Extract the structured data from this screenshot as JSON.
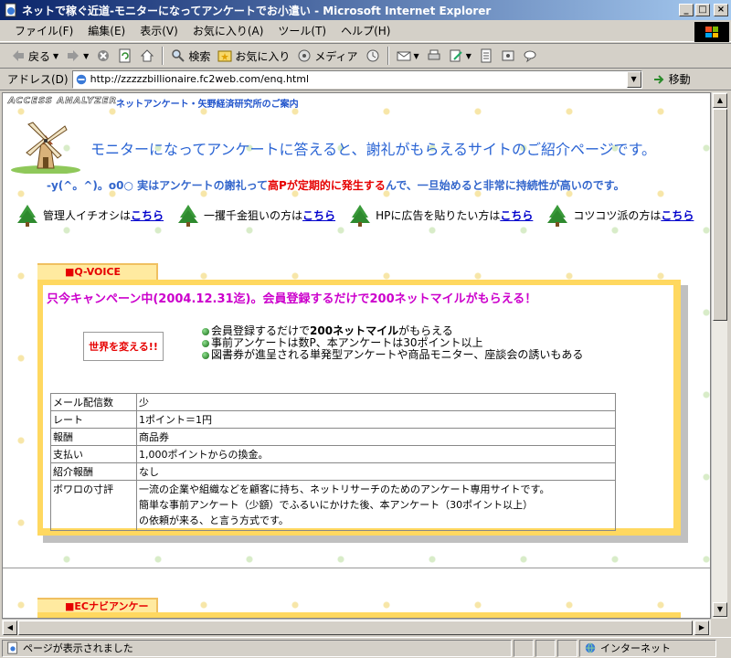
{
  "window": {
    "title": "ネットで稼ぐ近道-モニターになってアンケートでお小遣い - Microsoft Internet Explorer",
    "min": "_",
    "max": "□",
    "close": "×"
  },
  "menu": [
    "ファイル(F)",
    "編集(E)",
    "表示(V)",
    "お気に入り(A)",
    "ツール(T)",
    "ヘルプ(H)"
  ],
  "toolbar": {
    "back": "戻る",
    "search": "検索",
    "favorites": "お気に入り",
    "media": "メディア"
  },
  "address": {
    "label": "アドレス(D)",
    "url": "http://zzzzzbillionaire.fc2web.com/enq.html",
    "go": "移動"
  },
  "page": {
    "access_logo": "ACCESS ANALYZER",
    "header_link": "ネットアンケート・矢野経済研究所のご案内",
    "main_title": "モニターになってアンケートに答えると、謝礼がもらえるサイトのご紹介ページです。",
    "sub_line_pre": "-y(^。^)。o0○ 実はアンケートの謝礼って",
    "sub_line_red": "高Pが定期的に発生する",
    "sub_line_post": "んで、一旦始めると非常に持続性が高いのです。",
    "nav": [
      {
        "text": "管理人イチオシは",
        "link": "こちら"
      },
      {
        "text": "一攫千金狙いの方は",
        "link": "こちら"
      },
      {
        "text": "HPに広告を貼りたい方は",
        "link": "こちら"
      },
      {
        "text": "コツコツ派の方は",
        "link": "こちら"
      }
    ],
    "section1": {
      "tab": "■Q-VOICE",
      "campaign": "只今キャンペーン中(2004.12.31迄)。会員登録するだけで200ネットマイルがもらえる！",
      "banner": "世界を変える!!",
      "bullet1_pre": "会員登録するだけで",
      "bullet1_bold": "200ネットマイル",
      "bullet1_post": "がもらえる",
      "bullet2": "事前アンケートは数P、本アンケートは30ポイント以上",
      "bullet3": "図書券が進呈される単発型アンケートや商品モニター、座談会の誘いもある",
      "table": [
        {
          "k": "メール配信数",
          "v": "少"
        },
        {
          "k": "レート",
          "v": "1ポイント＝1円"
        },
        {
          "k": "報酬",
          "v": "商品券"
        },
        {
          "k": "支払い",
          "v": "1,000ポイントからの換金。"
        },
        {
          "k": "紹介報酬",
          "v": "なし"
        }
      ],
      "review_key": "ボワロの寸評",
      "review_1": "一流の企業や組織などを顧客に持ち、ネットリサーチのためのアンケート専用サイトです。",
      "review_2": "簡単な事前アンケート（少額）でふるいにかけた後、本アンケート（30ポイント以上）",
      "review_3": "の依頼が来る、と言う方式です。"
    },
    "section2": {
      "tab": "■ECナビアンケート"
    }
  },
  "status": {
    "text": "ページが表示されました",
    "zone": "インターネット"
  }
}
